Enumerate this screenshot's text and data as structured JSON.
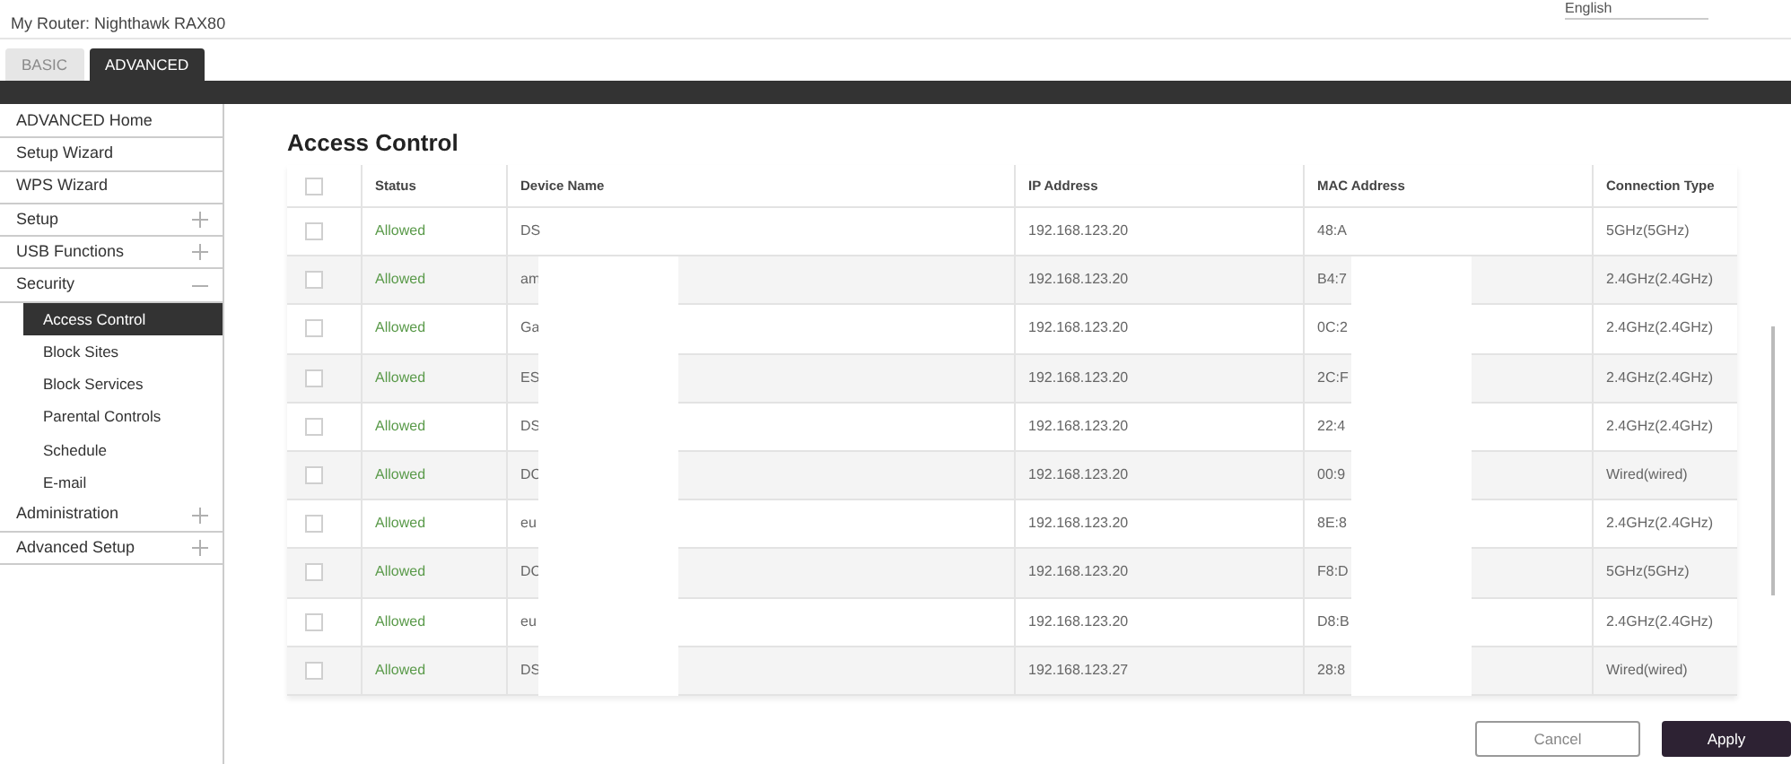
{
  "header": {
    "router_label": "My Router:",
    "router_name": "Nighthawk RAX80",
    "language": "English"
  },
  "tabs": [
    {
      "label": "BASIC",
      "selected": false
    },
    {
      "label": "ADVANCED",
      "selected": true
    }
  ],
  "sidebar": {
    "items": [
      {
        "label": "ADVANCED Home",
        "selected": false
      },
      {
        "label": "Setup Wizard",
        "selected": false
      },
      {
        "label": "WPS Wizard",
        "selected": false
      },
      {
        "label": "Setup",
        "selected": false,
        "expanded": false
      },
      {
        "label": "USB Functions",
        "selected": false,
        "expanded": false
      },
      {
        "label": "Security",
        "selected": false,
        "expanded": true,
        "children": [
          {
            "label": "Access Control",
            "selected": true
          },
          {
            "label": "Block Sites",
            "selected": false
          },
          {
            "label": "Block Services",
            "selected": false
          },
          {
            "label": "Parental Controls",
            "selected": false
          },
          {
            "label": "Schedule",
            "selected": false
          },
          {
            "label": "E-mail",
            "selected": false
          }
        ]
      },
      {
        "label": "Administration",
        "selected": false,
        "expanded": false
      },
      {
        "label": "Advanced Setup",
        "selected": false,
        "expanded": false
      }
    ]
  },
  "page_title": "Access Control",
  "table": {
    "select_all_checked": false,
    "columns": [
      "Status",
      "Device Name",
      "IP Address",
      "MAC Address",
      "Connection Type"
    ],
    "rows": [
      {
        "checked": false,
        "status": "Allowed",
        "device": "DS",
        "ip": "192.168.123.20",
        "mac": "48:A",
        "connection": "5GHz(5GHz)"
      },
      {
        "checked": false,
        "status": "Allowed",
        "device": "am",
        "ip": "192.168.123.20",
        "mac": "B4:7",
        "connection": "2.4GHz(2.4GHz)"
      },
      {
        "checked": false,
        "status": "Allowed",
        "device": "Ga",
        "ip": "192.168.123.20",
        "mac": "0C:2",
        "connection": "2.4GHz(2.4GHz)"
      },
      {
        "checked": false,
        "status": "Allowed",
        "device": "ES",
        "ip": "192.168.123.20",
        "mac": "2C:F",
        "connection": "2.4GHz(2.4GHz)"
      },
      {
        "checked": false,
        "status": "Allowed",
        "device": "DS",
        "ip": "192.168.123.20",
        "mac": "22:4",
        "connection": "2.4GHz(2.4GHz)"
      },
      {
        "checked": false,
        "status": "Allowed",
        "device": "DC",
        "ip": "192.168.123.20",
        "mac": "00:9",
        "connection": "Wired(wired)"
      },
      {
        "checked": false,
        "status": "Allowed",
        "device": "eu",
        "ip": "192.168.123.20",
        "mac": "8E:8",
        "connection": "2.4GHz(2.4GHz)"
      },
      {
        "checked": false,
        "status": "Allowed",
        "device": "DC",
        "ip": "192.168.123.20",
        "mac": "F8:D",
        "connection": "5GHz(5GHz)"
      },
      {
        "checked": false,
        "status": "Allowed",
        "device": "eu",
        "ip": "192.168.123.20",
        "mac": "D8:B",
        "connection": "2.4GHz(2.4GHz)"
      },
      {
        "checked": false,
        "status": "Allowed",
        "device": "DS",
        "ip": "192.168.123.27",
        "mac": "28:8",
        "connection": "Wired(wired)"
      }
    ]
  },
  "buttons": [
    {
      "label": "Cancel",
      "kind": "secondary"
    },
    {
      "label": "Apply",
      "kind": "primary"
    }
  ]
}
